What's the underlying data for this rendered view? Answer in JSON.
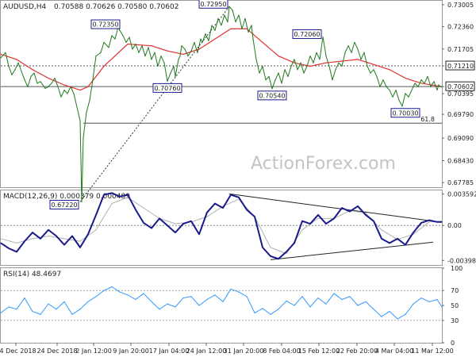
{
  "header": {
    "symbol": "AUDUSD,H4",
    "ohlc": "0.70588 0.70626 0.70580 0.70602"
  },
  "watermark": "ActionForex.com",
  "colors": {
    "price": "#1f7a1f",
    "ma": "#e03030",
    "level": "#555555",
    "macd": "#1a1a8c",
    "signal": "#b0b0b0",
    "rsi": "#3399ff",
    "box_border": "#1a1a8c",
    "current_box": "#222222"
  },
  "chart_data": [
    {
      "type": "line",
      "title": "AUDUSD,H4",
      "ylim": [
        0.6765,
        0.7312
      ],
      "y_ticks": [
        "0.73005",
        "0.72360",
        "0.71705",
        "0.71210",
        "0.70602",
        "0.70395",
        "0.69790",
        "0.69090",
        "0.68430",
        "0.67785"
      ],
      "x_ticks": [
        "14 Dec 2018",
        "24 Dec 2018",
        "2 Jan 12:00",
        "9 Jan 20:00",
        "17 Jan 04:00",
        "24 Jan 12:00",
        "31 Jan 20:00",
        "8 Feb 04:00",
        "15 Feb 12:00",
        "22 Feb 20:00",
        "4 Mar 04:00",
        "11 Mar 12:00"
      ],
      "series": [
        {
          "name": "",
          "x": [
            0,
            6,
            10,
            14,
            18,
            22,
            26,
            30,
            34,
            38,
            42,
            46,
            50,
            56,
            60,
            64,
            68,
            72,
            76,
            80,
            84,
            88,
            92,
            96,
            100,
            102,
            104,
            108,
            112,
            116,
            120,
            126,
            130,
            136,
            140,
            144,
            148,
            150,
            154,
            158,
            162,
            166,
            170,
            174,
            178,
            182,
            186,
            190,
            194,
            198,
            202,
            206,
            210,
            214,
            218,
            220,
            224,
            226,
            228,
            232,
            236,
            240,
            244,
            248,
            252,
            254,
            258,
            262,
            266,
            270,
            274,
            278,
            282,
            286,
            288,
            292,
            296,
            300,
            304,
            308,
            312,
            316,
            318,
            322,
            326,
            330,
            334,
            338,
            342,
            346,
            350,
            354,
            358,
            362,
            366,
            370,
            374,
            378,
            382,
            386,
            390,
            394,
            398,
            402,
            406,
            410,
            414,
            418,
            422,
            426,
            430,
            434,
            438,
            442,
            446,
            450,
            454,
            458,
            462,
            466,
            470,
            474,
            478,
            482,
            486,
            490,
            494,
            498,
            502,
            506,
            510,
            514,
            518,
            522,
            526,
            530,
            534,
            538,
            542,
            546,
            550,
            552,
            554,
            556
          ],
          "values": [
            0.7145,
            0.716,
            0.712,
            0.7095,
            0.711,
            0.713,
            0.7105,
            0.708,
            0.706,
            0.709,
            0.71,
            0.707,
            0.7075,
            0.7055,
            0.706,
            0.707,
            0.7085,
            0.706,
            0.703,
            0.705,
            0.704,
            0.706,
            0.704,
            0.7,
            0.696,
            0.6722,
            0.691,
            0.6985,
            0.702,
            0.708,
            0.715,
            0.716,
            0.719,
            0.7175,
            0.721,
            0.72,
            0.7235,
            0.7225,
            0.721,
            0.719,
            0.7205,
            0.717,
            0.7185,
            0.716,
            0.718,
            0.715,
            0.7175,
            0.714,
            0.716,
            0.712,
            0.715,
            0.713,
            0.7076,
            0.71,
            0.712,
            0.709,
            0.714,
            0.715,
            0.718,
            0.717,
            0.715,
            0.7165,
            0.719,
            0.716,
            0.72,
            0.719,
            0.7215,
            0.7195,
            0.724,
            0.7225,
            0.726,
            0.724,
            0.727,
            0.725,
            0.7295,
            0.7285,
            0.725,
            0.727,
            0.723,
            0.726,
            0.722,
            0.724,
            0.72,
            0.714,
            0.71,
            0.712,
            0.708,
            0.709,
            0.7054,
            0.708,
            0.71,
            0.707,
            0.711,
            0.709,
            0.712,
            0.714,
            0.711,
            0.713,
            0.71,
            0.712,
            0.715,
            0.713,
            0.716,
            0.714,
            0.7206,
            0.715,
            0.712,
            0.708,
            0.711,
            0.713,
            0.712,
            0.716,
            0.718,
            0.716,
            0.719,
            0.717,
            0.714,
            0.716,
            0.712,
            0.71,
            0.711,
            0.709,
            0.706,
            0.708,
            0.706,
            0.705,
            0.703,
            0.705,
            0.702,
            0.7003,
            0.704,
            0.703,
            0.705,
            0.707,
            0.706,
            0.708,
            0.707,
            0.709,
            0.706,
            0.7075,
            0.705,
            0.7065,
            0.706,
            0.706
          ]
        },
        {
          "name": "",
          "x": [
            0,
            20,
            40,
            60,
            80,
            100,
            110,
            130,
            160,
            190,
            210,
            230,
            250,
            270,
            290,
            310,
            330,
            350,
            370,
            390,
            410,
            430,
            450,
            470,
            490,
            510,
            530,
            556
          ],
          "values": [
            0.7155,
            0.714,
            0.711,
            0.7085,
            0.7065,
            0.705,
            0.706,
            0.712,
            0.7185,
            0.718,
            0.7165,
            0.7155,
            0.717,
            0.72,
            0.723,
            0.723,
            0.719,
            0.715,
            0.713,
            0.712,
            0.713,
            0.7135,
            0.714,
            0.7125,
            0.711,
            0.7085,
            0.707,
            0.706
          ]
        }
      ],
      "levels": [
        {
          "value": 0.7121,
          "label": "0.71210",
          "style": "dotted"
        },
        {
          "value": 0.70602,
          "label": "0.70602",
          "style": "solid"
        },
        {
          "value": 0.6953,
          "label": "61.8",
          "style": "solid",
          "from_x": 104
        }
      ],
      "annotations": [
        {
          "x": 100,
          "y": 0.6722,
          "label": "0.67220",
          "pos": "left"
        },
        {
          "x": 210,
          "y": 0.7076,
          "label": "0.70760",
          "pos": "below"
        },
        {
          "x": 152,
          "y": 0.7235,
          "label": "0.72350",
          "pos": "left"
        },
        {
          "x": 288,
          "y": 0.7295,
          "label": "0.72950",
          "pos": "left"
        },
        {
          "x": 342,
          "y": 0.7054,
          "label": "0.70540",
          "pos": "below"
        },
        {
          "x": 406,
          "y": 0.7206,
          "label": "0.72060",
          "pos": "left"
        },
        {
          "x": 510,
          "y": 0.7003,
          "label": "0.70030",
          "pos": "below"
        }
      ]
    },
    {
      "type": "line",
      "title": "MACD(12,26,9) 0.000379 0.000489",
      "ylim": [
        -0.0045,
        0.004
      ],
      "y_ticks": [
        "0.003592",
        "0.00",
        "-0.003986"
      ],
      "series": [
        {
          "name": "",
          "x": [
            0,
            10,
            20,
            30,
            40,
            50,
            60,
            70,
            80,
            90,
            100,
            110,
            120,
            130,
            140,
            150,
            160,
            170,
            180,
            190,
            200,
            210,
            220,
            230,
            240,
            250,
            260,
            270,
            280,
            290,
            300,
            310,
            320,
            330,
            340,
            350,
            360,
            370,
            380,
            390,
            400,
            410,
            420,
            430,
            440,
            450,
            460,
            470,
            480,
            490,
            500,
            510,
            520,
            530,
            540,
            550,
            556
          ],
          "values": [
            -0.002,
            -0.0026,
            -0.003,
            -0.0018,
            -0.0008,
            -0.0015,
            -0.0005,
            -0.0012,
            -0.0022,
            -0.0012,
            -0.0025,
            -0.001,
            0.0012,
            0.0035,
            0.0037,
            0.0033,
            0.0035,
            0.0018,
            0.0003,
            -0.0003,
            0.0008,
            0.0,
            -0.0008,
            0.0002,
            0.0005,
            -0.001,
            0.0015,
            0.0025,
            0.002,
            0.0035,
            0.0032,
            0.0018,
            0.001,
            -0.0025,
            -0.0035,
            -0.0038,
            -0.003,
            -0.002,
            0.0005,
            0.0002,
            0.0012,
            0.0002,
            0.0008,
            0.002,
            0.0016,
            0.0022,
            0.0012,
            0.0005,
            -0.0015,
            -0.002,
            -0.0015,
            -0.0022,
            -0.0008,
            0.0003,
            0.0006,
            0.0004,
            0.0004
          ]
        },
        {
          "name": "",
          "x": [
            0,
            20,
            40,
            60,
            80,
            100,
            120,
            140,
            160,
            180,
            200,
            220,
            240,
            260,
            280,
            300,
            320,
            340,
            360,
            380,
            400,
            420,
            440,
            460,
            480,
            500,
            520,
            540,
            556
          ],
          "values": [
            -0.0015,
            -0.002,
            -0.0015,
            -0.0012,
            -0.0015,
            -0.0018,
            -0.0005,
            0.0025,
            0.0032,
            0.002,
            0.0008,
            0.0002,
            0.0004,
            0.001,
            0.0022,
            0.003,
            0.001,
            -0.0025,
            -0.0032,
            -0.0005,
            0.0008,
            0.0008,
            0.0017,
            0.0014,
            -0.0005,
            -0.0016,
            -0.001,
            0.0004,
            0.0005
          ]
        }
      ],
      "trendlines": [
        {
          "x": [
            288,
            545
          ],
          "y": [
            0.0036,
            0.0005
          ]
        },
        {
          "x": [
            340,
            545
          ],
          "y": [
            -0.0039,
            -0.0019
          ]
        }
      ]
    },
    {
      "type": "line",
      "title": "RSI(14) 48.4697",
      "ylim": [
        0,
        100
      ],
      "y_ticks": [
        "100",
        "70",
        "50",
        "30",
        "0"
      ],
      "series": [
        {
          "name": "",
          "x": [
            0,
            10,
            20,
            30,
            40,
            50,
            60,
            70,
            80,
            90,
            100,
            110,
            120,
            130,
            140,
            150,
            160,
            170,
            180,
            190,
            200,
            210,
            220,
            230,
            240,
            250,
            260,
            270,
            280,
            290,
            300,
            310,
            320,
            330,
            340,
            350,
            360,
            370,
            380,
            390,
            400,
            410,
            420,
            430,
            440,
            450,
            460,
            470,
            480,
            490,
            500,
            510,
            520,
            530,
            540,
            550,
            556
          ],
          "values": [
            40,
            48,
            45,
            60,
            42,
            38,
            52,
            45,
            55,
            38,
            45,
            55,
            62,
            70,
            75,
            68,
            64,
            58,
            66,
            55,
            45,
            52,
            48,
            60,
            62,
            50,
            58,
            64,
            55,
            72,
            68,
            62,
            40,
            46,
            38,
            45,
            56,
            50,
            62,
            48,
            60,
            52,
            66,
            58,
            62,
            50,
            55,
            45,
            35,
            42,
            32,
            38,
            52,
            60,
            55,
            58,
            48
          ]
        }
      ]
    }
  ]
}
